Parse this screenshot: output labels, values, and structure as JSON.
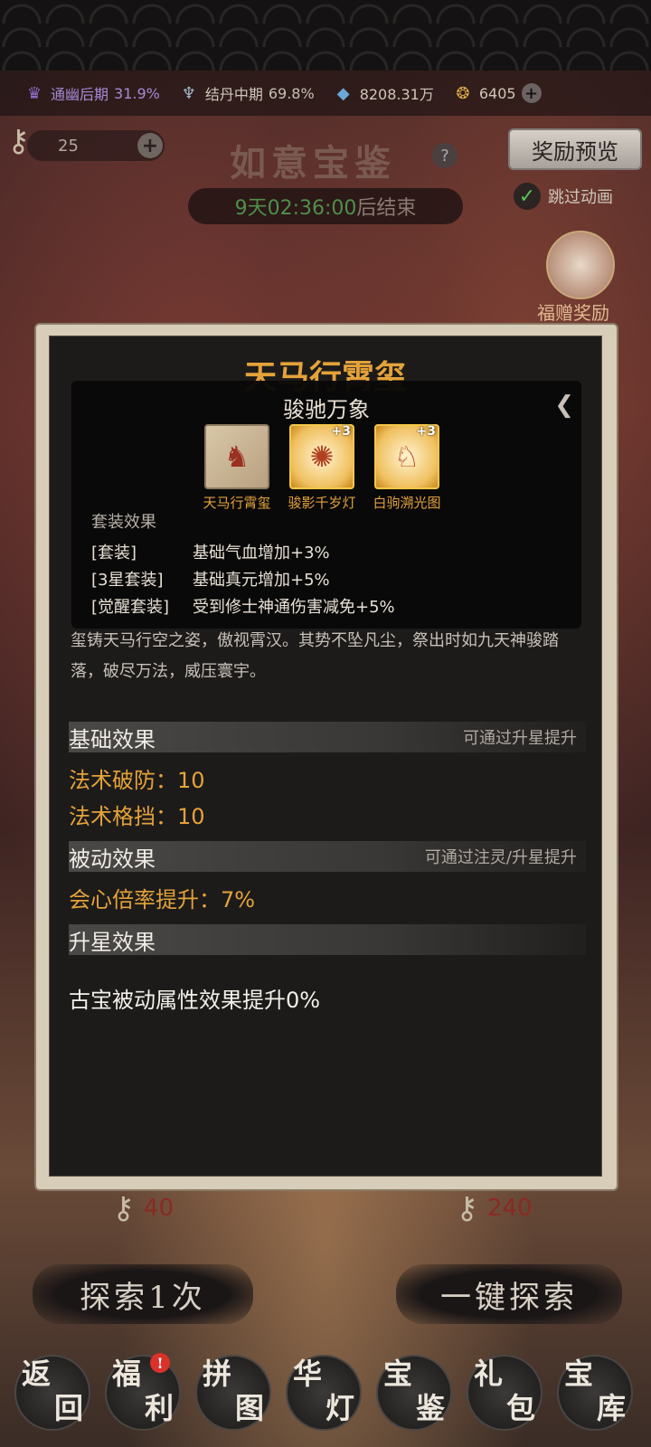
{
  "resources": [
    {
      "icon": "purple-realm-icon",
      "label": "通幽后期",
      "value": "31.9%"
    },
    {
      "icon": "fan-icon",
      "label": "结丹中期",
      "value": "69.8%"
    },
    {
      "icon": "crystal-icon",
      "label": "",
      "value": "8208.31万"
    },
    {
      "icon": "coin-icon",
      "label": "",
      "value": "6405"
    }
  ],
  "header": {
    "key_count": "25",
    "title": "如意宝鉴",
    "help": "?",
    "timer": "9天02:36:00",
    "timer_suffix": "后结束",
    "reward_preview": "奖励预览",
    "skip_animation": "跳过动画",
    "gift_label": "福赠奖励"
  },
  "item": {
    "title": "天马行霄玺",
    "set_name": "骏驰万象",
    "set_pieces": [
      {
        "name": "天马行霄玺",
        "badge": ""
      },
      {
        "name": "骏影千岁灯",
        "badge": "+3"
      },
      {
        "name": "白驹溯光图",
        "badge": "+3"
      }
    ],
    "set_effects_head": "套装效果",
    "set_effects": [
      {
        "key": "[套装]",
        "value": "基础气血增加+3%"
      },
      {
        "key": "[3星套装]",
        "value": "基础真元增加+5%"
      },
      {
        "key": "[觉醒套装]",
        "value": "受到修士神通伤害减免+5%"
      }
    ],
    "description": "玺铸天马行空之姿，傲视霄汉。其势不坠凡尘，祭出时如九天神骏踏落，破尽万法，威压寰宇。",
    "basic": {
      "title": "基础效果",
      "hint": "可通过升星提升",
      "stats": [
        "法术破防：10",
        "法术格挡：10"
      ]
    },
    "passive": {
      "title": "被动效果",
      "hint": "可通过注灵/升星提升",
      "stats": [
        "会心倍率提升：7%"
      ]
    },
    "star": {
      "title": "升星效果",
      "text": "古宝被动属性效果提升0%"
    }
  },
  "explore": {
    "single_cost": "40",
    "single_label": "探索1次",
    "multi_cost": "240",
    "multi_label": "一键探索"
  },
  "nav": [
    {
      "c1": "返",
      "c2": "回"
    },
    {
      "c1": "福",
      "c2": "利",
      "badge": "!"
    },
    {
      "c1": "拼",
      "c2": "图"
    },
    {
      "c1": "华",
      "c2": "灯"
    },
    {
      "c1": "宝",
      "c2": "鉴"
    },
    {
      "c1": "礼",
      "c2": "包"
    },
    {
      "c1": "宝",
      "c2": "库"
    }
  ],
  "colors": {
    "accent_gold": "#e4a23a",
    "timer_green": "#4f8f4a",
    "cost_red": "#8a2a22"
  }
}
